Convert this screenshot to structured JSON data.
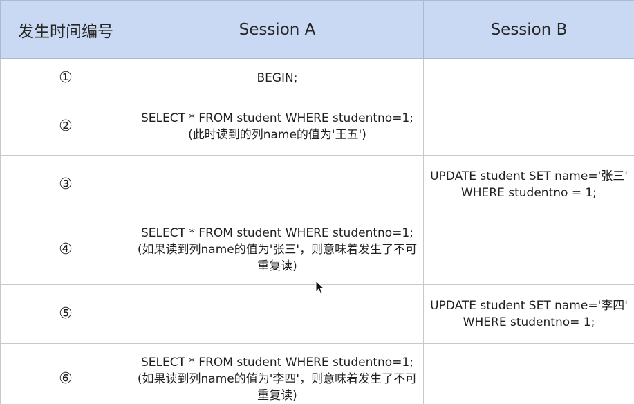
{
  "header": {
    "col1": "发生时间编号",
    "col2": "Session A",
    "col3": "Session B"
  },
  "rows": [
    {
      "num": "①",
      "a": "BEGIN;",
      "a_note": "",
      "b": ""
    },
    {
      "num": "②",
      "a": "SELECT * FROM student WHERE studentno=1;",
      "a_note": "(此时读到的列name的值为'王五')",
      "b": ""
    },
    {
      "num": "③",
      "a": "",
      "a_note": "",
      "b": "UPDATE student SET name='张三' WHERE studentno = 1;"
    },
    {
      "num": "④",
      "a": "SELECT * FROM student WHERE studentno=1;",
      "a_note": "(如果读到列name的值为'张三'，则意味着发生了不可重复读)",
      "b": ""
    },
    {
      "num": "⑤",
      "a": "",
      "a_note": "",
      "b": "UPDATE student SET name='李四' WHERE studentno= 1;"
    },
    {
      "num": "⑥",
      "a": "SELECT * FROM student WHERE studentno=1;",
      "a_note": "(如果读到列name的值为'李四'，则意味着发生了不可重复读)",
      "b": ""
    }
  ]
}
